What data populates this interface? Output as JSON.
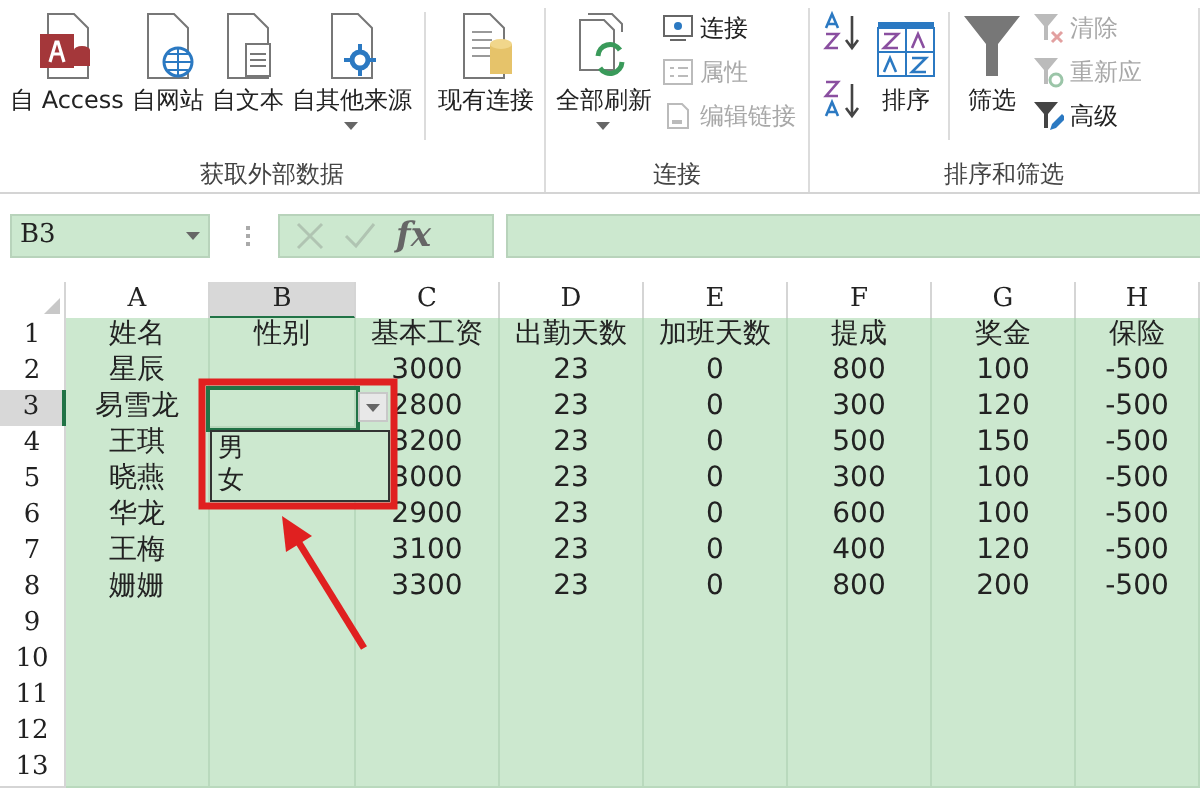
{
  "ribbon": {
    "groups": [
      {
        "label": "获取外部数据",
        "items": [
          {
            "kind": "large",
            "label": "自 Access"
          },
          {
            "kind": "large",
            "label": "自网站"
          },
          {
            "kind": "large",
            "label": "自文本"
          },
          {
            "kind": "large",
            "label": "自其他来源",
            "has_menu": true
          },
          {
            "kind": "separator"
          },
          {
            "kind": "large",
            "label": "现有连接"
          }
        ]
      },
      {
        "label": "连接",
        "items": [
          {
            "kind": "large",
            "label": "全部刷新",
            "has_menu": true
          },
          {
            "kind": "stack",
            "items": [
              {
                "label": "连接",
                "disabled": false
              },
              {
                "label": "属性",
                "disabled": true
              },
              {
                "label": "编辑链接",
                "disabled": true
              }
            ]
          }
        ]
      },
      {
        "label": "排序和筛选",
        "items": [
          {
            "kind": "stack",
            "items": [
              {
                "disabled": false
              },
              {
                "disabled": false
              }
            ]
          },
          {
            "kind": "large",
            "label": "排序"
          },
          {
            "kind": "separator"
          },
          {
            "kind": "large",
            "label": "筛选"
          },
          {
            "kind": "stack",
            "items": [
              {
                "label": "清除",
                "disabled": true
              },
              {
                "label": "重新应",
                "disabled": true
              },
              {
                "label": "高级",
                "disabled": false
              }
            ]
          }
        ]
      }
    ]
  },
  "formula_bar": {
    "name_box": "B3",
    "function_label": "fx"
  },
  "sheet": {
    "columns": [
      {
        "label": "A",
        "selected": false
      },
      {
        "label": "B",
        "selected": true
      },
      {
        "label": "C",
        "selected": false
      },
      {
        "label": "D",
        "selected": false
      },
      {
        "label": "E",
        "selected": false
      },
      {
        "label": "F",
        "selected": false
      },
      {
        "label": "G",
        "selected": false
      },
      {
        "label": "H",
        "selected": false
      }
    ],
    "rows": [
      {
        "number": "1",
        "selected": false,
        "cells": [
          "姓名",
          "性别",
          "基本工资",
          "出勤天数",
          "加班天数",
          "提成",
          "奖金",
          "保险"
        ]
      },
      {
        "number": "2",
        "selected": false,
        "cells": [
          "星辰",
          null,
          "3000",
          "23",
          "0",
          "800",
          "100",
          "-500"
        ]
      },
      {
        "number": "3",
        "selected": true,
        "cells": [
          "易雪龙",
          null,
          "2800",
          "23",
          "0",
          "300",
          "120",
          "-500"
        ]
      },
      {
        "number": "4",
        "selected": false,
        "cells": [
          "王琪",
          null,
          "3200",
          "23",
          "0",
          "500",
          "150",
          "-500"
        ]
      },
      {
        "number": "5",
        "selected": false,
        "cells": [
          "晓燕",
          null,
          "3000",
          "23",
          "0",
          "300",
          "100",
          "-500"
        ]
      },
      {
        "number": "6",
        "selected": false,
        "cells": [
          "华龙",
          null,
          "2900",
          "23",
          "0",
          "600",
          "100",
          "-500"
        ]
      },
      {
        "number": "7",
        "selected": false,
        "cells": [
          "王梅",
          null,
          "3100",
          "23",
          "0",
          "400",
          "120",
          "-500"
        ]
      },
      {
        "number": "8",
        "selected": false,
        "cells": [
          "姗姗",
          null,
          "3300",
          "23",
          "0",
          "800",
          "200",
          "-500"
        ]
      },
      {
        "number": "9",
        "selected": false
      },
      {
        "number": "10",
        "selected": false
      },
      {
        "number": "11",
        "selected": false
      },
      {
        "number": "12",
        "selected": false
      },
      {
        "number": "13",
        "selected": false
      }
    ],
    "dropdown": {
      "options": [
        "男",
        "女"
      ]
    }
  }
}
